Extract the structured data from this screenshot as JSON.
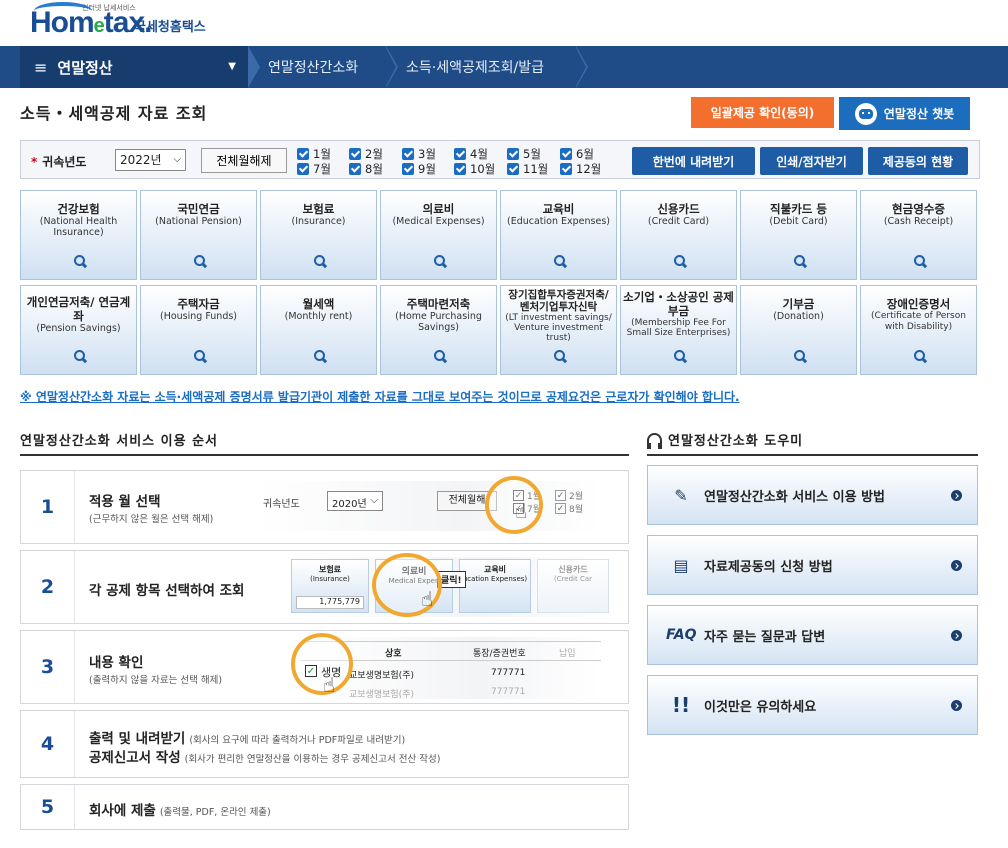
{
  "header": {
    "logo_tagline": "인터넷 납세서비스",
    "logo_text_pre": "Hom",
    "logo_text_e": "e",
    "logo_text_post": "tax.",
    "logo_kr": "국세청홈택스"
  },
  "nav": {
    "menu_label": "연말정산",
    "breadcrumbs": [
      "연말정산간소화",
      "소득·세액공제조회/발급"
    ]
  },
  "page": {
    "title": "소득・세액공제 자료 조회",
    "btn_bulk_confirm": "일괄제공 확인(동의)",
    "btn_chatbot": "연말정산 챗봇"
  },
  "filter": {
    "year_label": "귀속년도",
    "year_value": "2022년",
    "btn_toggle_all": "전체월해제",
    "months": [
      "1월",
      "2월",
      "3월",
      "4월",
      "5월",
      "6월",
      "7월",
      "8월",
      "9월",
      "10월",
      "11월",
      "12월"
    ],
    "btn_download_all": "한번에 내려받기",
    "btn_print": "인쇄/점자받기",
    "btn_consent_status": "제공동의 현황"
  },
  "categories": [
    {
      "kr": "건강보험",
      "en": "(National Health Insurance)"
    },
    {
      "kr": "국민연금",
      "en": "(National Pension)"
    },
    {
      "kr": "보험료",
      "en": "(Insurance)"
    },
    {
      "kr": "의료비",
      "en": "(Medical Expenses)"
    },
    {
      "kr": "교육비",
      "en": "(Education Expenses)"
    },
    {
      "kr": "신용카드",
      "en": "(Credit Card)"
    },
    {
      "kr": "직불카드 등",
      "en": "(Debit Card)"
    },
    {
      "kr": "현금영수증",
      "en": "(Cash Receipt)"
    },
    {
      "kr": "개인연금저축/ 연금계좌",
      "en": "(Pension Savings)"
    },
    {
      "kr": "주택자금",
      "en": "(Housing Funds)"
    },
    {
      "kr": "월세액",
      "en": "(Monthly rent)"
    },
    {
      "kr": "주택마련저축",
      "en": "(Home Purchasing Savings)"
    },
    {
      "kr": "장기집합투자증권저축/ 벤처기업투자신탁",
      "en": "(LT investment savings/ Venture investment trust)"
    },
    {
      "kr": "소기업・소상공인 공제부금",
      "en": "(Membership Fee For Small Size Enterprises)"
    },
    {
      "kr": "기부금",
      "en": "(Donation)"
    },
    {
      "kr": "장애인증명서",
      "en": "(Certificate of Person with Disability)"
    }
  ],
  "notice": "※ 연말정산간소화 자료는 소득·세액공제 증명서류 발급기관이 제출한 자료를 그대로 보여주는 것이므로 공제요건은 근로자가 확인해야 합니다.",
  "steps": {
    "title": "연말정산간소화 서비스 이용 순서",
    "items": [
      {
        "num": "1",
        "main": "적용 월 선택",
        "sub": "(근무하지 않은 월은 선택 해제)"
      },
      {
        "num": "2",
        "main": "각 공제 항목 선택하여 조회",
        "sub": ""
      },
      {
        "num": "3",
        "main": "내용 확인",
        "sub": "(출력하지 않을 자료는 선택 해제)"
      },
      {
        "num": "4",
        "main": "출력 및 내려받기",
        "main2": "공제신고서 작성",
        "sub": "(회사의 요구에 따라 출력하거나 PDF파일로 내려받기)",
        "sub2": "(회사가 편리한 연말정산을 이용하는 경우 공제신고서 전산 작성)"
      },
      {
        "num": "5",
        "main": "회사에 제출",
        "sub": "(출력물, PDF, 온라인 제출)"
      }
    ],
    "thumb1": {
      "label": "귀속년도",
      "year": "2020년",
      "btn": "전체월해",
      "m1": "1월",
      "m2": "2월",
      "m7": "7월",
      "m8": "8월"
    },
    "thumb2": {
      "c1": "보험료",
      "c1en": "(Insurance)",
      "c1val": "1,775,779",
      "c2": "의료비",
      "c2en": "Medical Expen",
      "c3": "교육비",
      "c3en": "ucation Expenses)",
      "c4": "신용카드",
      "c4en": "(Credit Car",
      "click": "클릭!"
    },
    "thumb3": {
      "h1": "상호",
      "h2": "통장/증권번호",
      "h3": "납입",
      "row": "생명",
      "row_name": "교보생명보험(주)",
      "row_num": "777771",
      "row2_name": "교보생명보험(주)",
      "row2_num": "777771"
    }
  },
  "help": {
    "title": "연말정산간소화 도우미",
    "items": [
      {
        "icon": "✎",
        "label": "연말정산간소화 서비스 이용 방법"
      },
      {
        "icon": "▤",
        "label": "자료제공동의 신청 방법"
      },
      {
        "icon": "FAQ",
        "label": "자주 묻는 질문과 답변"
      },
      {
        "icon": "!!",
        "label": "이것만은 유의하세요"
      }
    ]
  }
}
